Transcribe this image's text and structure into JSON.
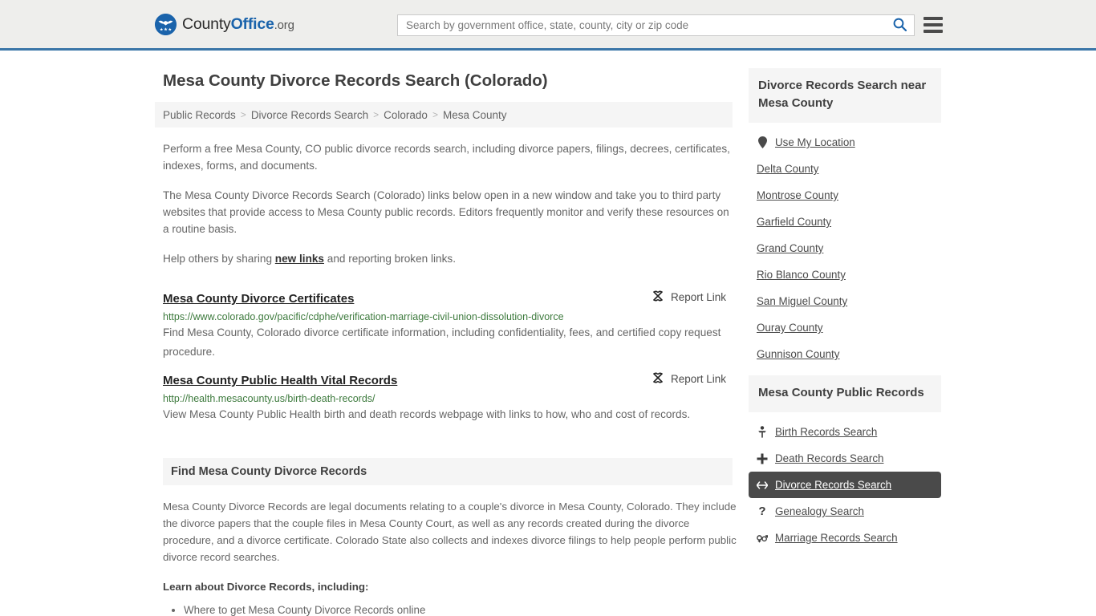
{
  "header": {
    "brand": {
      "part1": "County",
      "part2": "Office",
      "part3": ".org"
    },
    "search": {
      "placeholder": "Search by government office, state, county, city or zip code",
      "value": ""
    },
    "accent_color": "#3b76a8",
    "background_color": "#eeeeec"
  },
  "page": {
    "title": "Mesa County Divorce Records Search (Colorado)"
  },
  "breadcrumb": {
    "items": [
      {
        "label": "Public Records"
      },
      {
        "label": "Divorce Records Search"
      },
      {
        "label": "Colorado"
      },
      {
        "label": "Mesa County"
      }
    ],
    "separator": ">"
  },
  "intro": {
    "p1": "Perform a free Mesa County, CO public divorce records search, including divorce papers, filings, decrees, certificates, indexes, forms, and documents.",
    "p2": "The Mesa County Divorce Records Search (Colorado) links below open in a new window and take you to third party websites that provide access to Mesa County public records. Editors frequently monitor and verify these resources on a routine basis.",
    "p3_before": "Help others by sharing ",
    "p3_link": "new links",
    "p3_after": " and reporting broken links."
  },
  "results": {
    "report_label": "Report Link",
    "items": [
      {
        "title": "Mesa County Divorce Certificates",
        "url": "https://www.colorado.gov/pacific/cdphe/verification-marriage-civil-union-dissolution-divorce",
        "description": "Find Mesa County, Colorado divorce certificate information, including confidentiality, fees, and certified copy request procedure."
      },
      {
        "title": "Mesa County Public Health Vital Records",
        "url": "http://health.mesacounty.us/birth-death-records/",
        "description": "View Mesa County Public Health birth and death records webpage with links to how, who and cost of records."
      }
    ]
  },
  "find_section": {
    "heading": "Find Mesa County Divorce Records",
    "paragraph": "Mesa County Divorce Records are legal documents relating to a couple's divorce in Mesa County, Colorado. They include the divorce papers that the couple files in Mesa County Court, as well as any records created during the divorce procedure, and a divorce certificate. Colorado State also collects and indexes divorce filings to help people perform public divorce record searches.",
    "learn_heading": "Learn about Divorce Records, including:",
    "bullets": [
      "Where to get Mesa County Divorce Records online"
    ]
  },
  "sidebar": {
    "nearby": {
      "heading": "Divorce Records Search near Mesa County",
      "items": [
        {
          "label": "Use My Location",
          "icon": "map-pin-icon"
        },
        {
          "label": "Delta County",
          "icon": ""
        },
        {
          "label": "Montrose County",
          "icon": ""
        },
        {
          "label": "Garfield County",
          "icon": ""
        },
        {
          "label": "Grand County",
          "icon": ""
        },
        {
          "label": "Rio Blanco County",
          "icon": ""
        },
        {
          "label": "San Miguel County",
          "icon": ""
        },
        {
          "label": "Ouray County",
          "icon": ""
        },
        {
          "label": "Gunnison County",
          "icon": ""
        }
      ]
    },
    "public_records": {
      "heading": "Mesa County Public Records",
      "items": [
        {
          "label": "Birth Records Search",
          "icon": "baby-icon",
          "active": false
        },
        {
          "label": "Death Records Search",
          "icon": "cross-icon",
          "active": false
        },
        {
          "label": "Divorce Records Search",
          "icon": "left-right-arrow-icon",
          "active": true
        },
        {
          "label": "Genealogy Search",
          "icon": "question-mark-icon",
          "active": false
        },
        {
          "label": "Marriage Records Search",
          "icon": "male-female-icon",
          "active": false
        }
      ],
      "active_background": "#4a4a4a"
    }
  }
}
